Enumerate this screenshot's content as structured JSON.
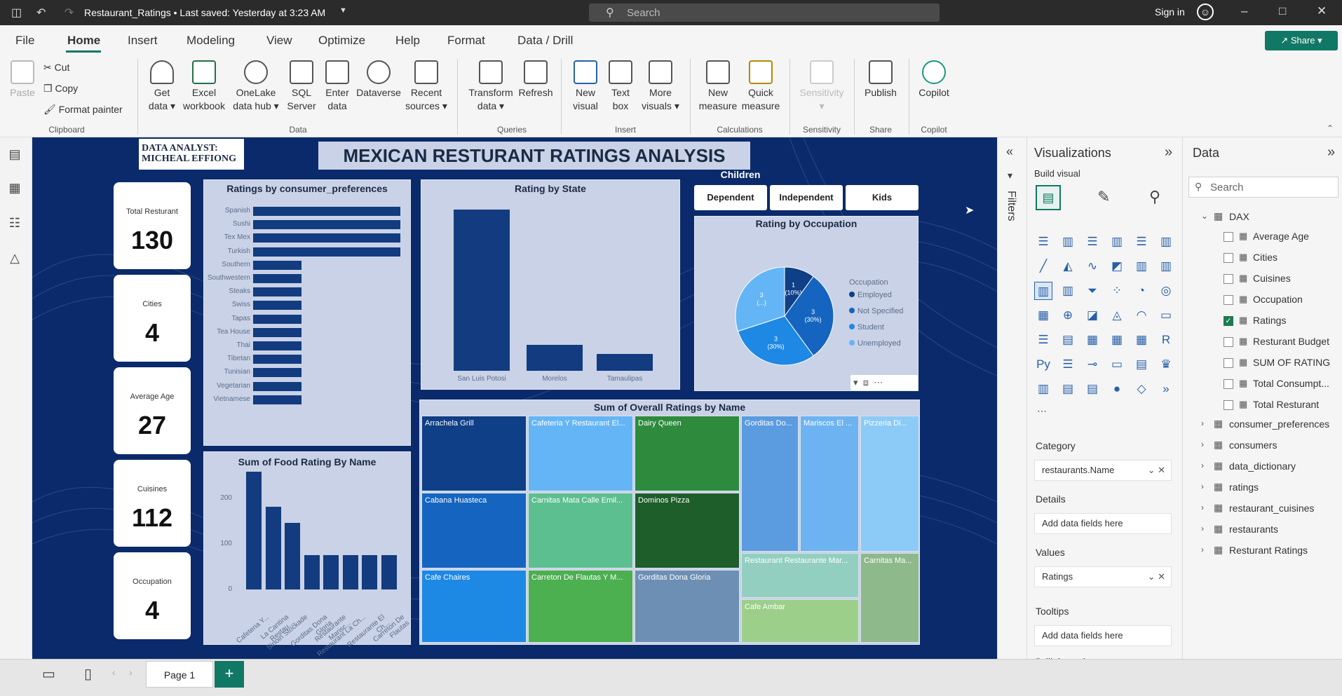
{
  "titlebar": {
    "doc_title": "Restaurant_Ratings • Last saved: Yesterday at 3:23 AM",
    "search_placeholder": "Search",
    "signin": "Sign in"
  },
  "menu": [
    "File",
    "Home",
    "Insert",
    "Modeling",
    "View",
    "Optimize",
    "Help",
    "Format",
    "Data / Drill"
  ],
  "share_label": "Share",
  "ribbon": {
    "clipboard": {
      "paste": "Paste",
      "cut": "Cut",
      "copy": "Copy",
      "format_painter": "Format painter",
      "group": "Clipboard"
    },
    "data": {
      "get_data": [
        "Get",
        "data"
      ],
      "excel": [
        "Excel",
        "workbook"
      ],
      "onelake": [
        "OneLake",
        "data hub"
      ],
      "sql": [
        "SQL",
        "Server"
      ],
      "enter": [
        "Enter",
        "data"
      ],
      "dataverse": [
        "Dataverse",
        ""
      ],
      "recent": [
        "Recent",
        "sources"
      ],
      "group": "Data"
    },
    "queries": {
      "transform": [
        "Transform",
        "data"
      ],
      "refresh": [
        "Refresh",
        ""
      ],
      "group": "Queries"
    },
    "insert": {
      "new_visual": [
        "New",
        "visual"
      ],
      "text_box": [
        "Text",
        "box"
      ],
      "more_visuals": [
        "More",
        "visuals"
      ],
      "group": "Insert"
    },
    "calculations": {
      "new_measure": [
        "New",
        "measure"
      ],
      "quick_measure": [
        "Quick",
        "measure"
      ],
      "group": "Calculations"
    },
    "sensitivity": {
      "label": [
        "Sensitivity",
        ""
      ],
      "group": "Sensitivity"
    },
    "share": {
      "publish": [
        "Publish",
        ""
      ],
      "group": "Share"
    },
    "copilot": {
      "label": [
        "Copilot",
        ""
      ],
      "group": "Copilot"
    }
  },
  "report": {
    "author_line1": "DATA ANALYST:",
    "author_line2": "MICHEAL EFFIONG",
    "title": "MEXICAN RESTURANT RATINGS ANALYSIS",
    "cards": [
      {
        "label": "Total Resturant",
        "value": "130"
      },
      {
        "label": "Cities",
        "value": "4"
      },
      {
        "label": "Average Age",
        "value": "27"
      },
      {
        "label": "Cuisines",
        "value": "112"
      },
      {
        "label": "Occupation",
        "value": "4"
      }
    ],
    "children": {
      "title": "Children",
      "buttons": [
        "Dependent",
        "Independent",
        "Kids"
      ]
    }
  },
  "chart_data": [
    {
      "type": "bar",
      "orientation": "horizontal",
      "title": "Ratings by consumer_preferences",
      "categories": [
        "Spanish",
        "Sushi",
        "Tex Mex",
        "Turkish",
        "Southern",
        "Southwestern",
        "Steaks",
        "Swiss",
        "Tapas",
        "Tea House",
        "Thai",
        "Tibetan",
        "Tunisian",
        "Vegetarian",
        "Vietnamese"
      ],
      "values": [
        100,
        100,
        100,
        100,
        33,
        33,
        33,
        33,
        33,
        33,
        33,
        33,
        33,
        33,
        33
      ]
    },
    {
      "type": "bar",
      "title": "Rating by State",
      "categories": [
        "San Luis Potosi",
        "Morelos",
        "Tamaulipas"
      ],
      "values": [
        850,
        135,
        88
      ]
    },
    {
      "type": "pie",
      "title": "Rating by Occupation",
      "legend_title": "Occupation",
      "legend_position": "right",
      "slices": [
        {
          "name": "Employed",
          "value": 10,
          "label": "1\n(10%)",
          "color": "#0f3f86"
        },
        {
          "name": "Not Specified",
          "value": 30,
          "label": "3\n(30%)",
          "color": "#1565c0"
        },
        {
          "name": "Student",
          "value": 30,
          "label": "3\n(30%)",
          "color": "#1e88e5"
        },
        {
          "name": "Unemployed",
          "value": 30,
          "label": "3\n(...)",
          "color": "#64b5f6"
        }
      ]
    },
    {
      "type": "bar",
      "title": "Sum of Food Rating By Name",
      "categories": [
        "Cafeteria Y...",
        "La Cantina Restau...",
        "Sirloin Stockade",
        "Gorditas Dona Gloria",
        "Restaurante Marisc...",
        "Restaurant La Ch...",
        "Restaurante El Ch...",
        "Carreton De Flautas"
      ],
      "values": [
        258,
        181,
        146,
        75,
        75,
        75,
        75,
        75
      ],
      "ylim": [
        0,
        270
      ],
      "yticks": [
        0,
        100,
        200
      ]
    },
    {
      "type": "heatmap",
      "subtype": "treemap",
      "title": "Sum of Overall Ratings by Name",
      "items": [
        {
          "name": "Arrachela Grill",
          "color": "#0f3f86"
        },
        {
          "name": "Cafeteria Y Restaurant El...",
          "color": "#64b5f6"
        },
        {
          "name": "Dairy Queen",
          "color": "#2e8b3e"
        },
        {
          "name": "Gorditas Do...",
          "color": "#5b9be0"
        },
        {
          "name": "Mariscos El ...",
          "color": "#6db3f2"
        },
        {
          "name": "Pizzeria Di...",
          "color": "#8ccbf7"
        },
        {
          "name": "Cabana Huasteca",
          "color": "#1565c0"
        },
        {
          "name": "Carnitas Mata Calle Emil...",
          "color": "#5cbf8f"
        },
        {
          "name": "Dominos Pizza",
          "color": "#1d5e2b"
        },
        {
          "name": "Restaurant Restaurante Mar...",
          "color": "#93cfc0"
        },
        {
          "name": "Cafe Chaires",
          "color": "#1e88e5"
        },
        {
          "name": "Carreton De Flautas Y M...",
          "color": "#4caf50"
        },
        {
          "name": "Gorditas Dona Gloria",
          "color": "#6c8fb3"
        },
        {
          "name": "Cafe Ambar",
          "color": "#9ccf8a"
        },
        {
          "name": "Carnitas Ma...",
          "color": "#8eb98b"
        }
      ]
    }
  ],
  "visualizations": {
    "title": "Visualizations",
    "build_visual": "Build visual",
    "icons": [
      "R",
      "Py"
    ],
    "category_label": "Category",
    "category_value": "restaurants.Name",
    "details_label": "Details",
    "details_placeholder": "Add data fields here",
    "values_label": "Values",
    "values_value": "Ratings",
    "tooltips_label": "Tooltips",
    "tooltips_placeholder": "Add data fields here",
    "drill_label": "Drill through"
  },
  "filters_label": "Filters",
  "data_pane": {
    "title": "Data",
    "search_placeholder": "Search",
    "dax_label": "DAX",
    "measures": [
      {
        "name": "Average Age",
        "checked": false
      },
      {
        "name": "Cities",
        "checked": false
      },
      {
        "name": "Cuisines",
        "checked": false
      },
      {
        "name": "Occupation",
        "checked": false
      },
      {
        "name": "Ratings",
        "checked": true
      },
      {
        "name": "Resturant Budget",
        "checked": false
      },
      {
        "name": "SUM OF RATING",
        "checked": false
      },
      {
        "name": "Total Consumpt...",
        "checked": false
      },
      {
        "name": "Total Resturant",
        "checked": false
      }
    ],
    "tables": [
      "consumer_preferences",
      "consumers",
      "data_dictionary",
      "ratings",
      "restaurant_cuisines",
      "restaurants",
      "Resturant Ratings"
    ]
  },
  "bottom": {
    "page_tab": "Page 1",
    "add": "+"
  }
}
